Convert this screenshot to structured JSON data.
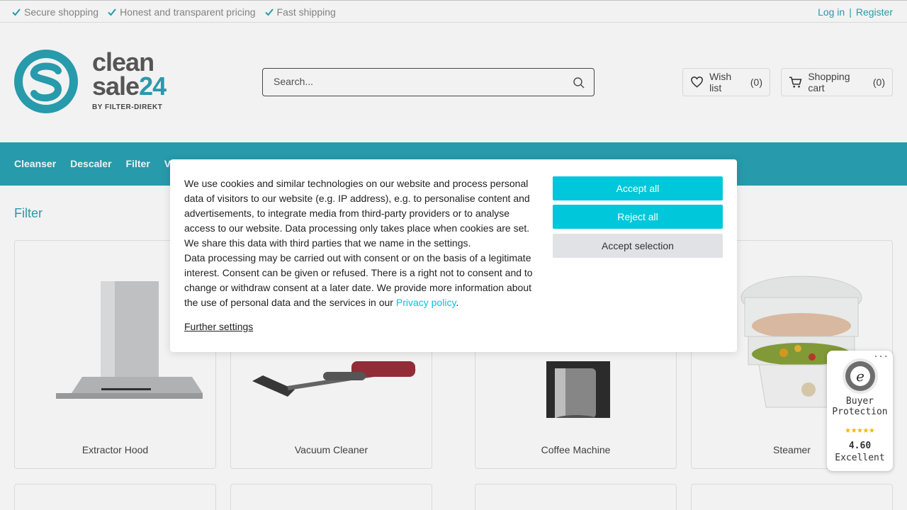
{
  "topbar": {
    "usps": [
      "Secure shopping",
      "Honest and transparent pricing",
      "Fast shipping"
    ],
    "login": "Log in",
    "separator": "|",
    "register": "Register"
  },
  "logo": {
    "line1": "clean",
    "line2": "sale",
    "line2_num": "24",
    "byline": "BY FILTER-DIREKT"
  },
  "search": {
    "placeholder": "Search..."
  },
  "header": {
    "wishlist_label": "Wish list",
    "wishlist_count": "(0)",
    "cart_label": "Shopping cart",
    "cart_count": "(0)"
  },
  "nav": {
    "items": [
      "Cleanser",
      "Descaler",
      "Filter",
      "V"
    ]
  },
  "page": {
    "title": "Filter"
  },
  "products": [
    {
      "name": "Extractor Hood"
    },
    {
      "name": "Vacuum Cleaner"
    },
    {
      "name": "Coffee Machine"
    },
    {
      "name": "Steamer"
    }
  ],
  "cookie": {
    "paragraph1": "We use cookies and similar technologies on our website and process personal data of visitors to our website (e.g. IP address), e.g. to personalise content and advertisements, to integrate media from third-party providers or to analyse access to our website. Data processing only takes place when cookies are set. We share this data with third parties that we name in the settings.",
    "paragraph2_before": "Data processing may be carried out with consent or on the basis of a legitimate interest. Consent can be given or refused. There is a right not to consent and to change or withdraw consent at a later date. We provide more information about the use of personal data and the services in our ",
    "privacy_link": "Privacy policy",
    "paragraph2_after": ".",
    "further_settings": "Further settings",
    "accept_all": "Accept all",
    "reject_all": "Reject all",
    "accept_selection": "Accept selection"
  },
  "trusted_badge": {
    "dots": "...",
    "title_line1": "Buyer",
    "title_line2": "Protection",
    "stars": "★★★★★",
    "score": "4.60",
    "label": "Excellent"
  },
  "colors": {
    "brand": "#2aa3b5",
    "button": "#00c7d9",
    "star": "#f2b700"
  }
}
